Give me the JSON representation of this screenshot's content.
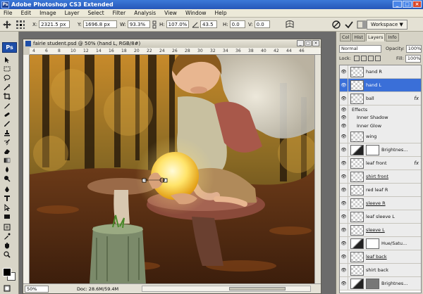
{
  "app": {
    "title": "Adobe Photoshop CS3 Extended",
    "badge": "Ps"
  },
  "menu": [
    "File",
    "Edit",
    "Image",
    "Layer",
    "Select",
    "Filter",
    "Analysis",
    "View",
    "Window",
    "Help"
  ],
  "options": {
    "x_label": "X:",
    "x_value": "2321.5 px",
    "y_label": "Y:",
    "y_value": "1696.8 px",
    "w_label": "W:",
    "w_value": "93.3%",
    "h_label": "H:",
    "h_value": "107.0%",
    "angle_value": "43.5",
    "hskew_label": "H:",
    "hskew_value": "0.0",
    "vskew_label": "V:",
    "vskew_value": "0.0",
    "workspace_label": "Workspace ▼"
  },
  "document": {
    "title": "fairie student.psd @ 50% (hand L, RGB/8#)",
    "zoom": "50%",
    "doc_info": "Doc: 28.6M/59.4M",
    "ruler_ticks": [
      "4",
      "6",
      "8",
      "10",
      "12",
      "14",
      "16",
      "18",
      "20",
      "22",
      "24",
      "26",
      "28",
      "30",
      "32",
      "34",
      "36",
      "38",
      "40",
      "42",
      "44",
      "46"
    ]
  },
  "panel": {
    "tabs": [
      "Col",
      "Hist",
      "Layers",
      "Info"
    ],
    "blend_mode": "Normal",
    "opacity_label": "Opacity:",
    "opacity_value": "100%",
    "lock_label": "Lock:",
    "fill_label": "Fill:",
    "fill_value": "100%",
    "layers": [
      {
        "name": "hand R",
        "type": "pixel"
      },
      {
        "name": "hand L",
        "type": "pixel",
        "active": true
      },
      {
        "name": "ball",
        "type": "pixel",
        "fx": true
      },
      {
        "name": "Effects",
        "type": "sub"
      },
      {
        "name": "Inner Shadow",
        "type": "sub"
      },
      {
        "name": "Inner Glow",
        "type": "sub"
      },
      {
        "name": "wing",
        "type": "pixel"
      },
      {
        "name": "Brightnes...",
        "type": "adjust"
      },
      {
        "name": "leaf front",
        "type": "pixel",
        "fx": true
      },
      {
        "name": "shirt front",
        "type": "pixel",
        "underline": true
      },
      {
        "name": "red leaf R",
        "type": "pixel"
      },
      {
        "name": "sleeve R",
        "type": "pixel",
        "underline": true
      },
      {
        "name": "leaf sleeve L",
        "type": "pixel"
      },
      {
        "name": "sleeve L",
        "type": "pixel",
        "underline": true
      },
      {
        "name": "Hue/Satu...",
        "type": "adjust"
      },
      {
        "name": "leaf back",
        "type": "pixel",
        "underline": true
      },
      {
        "name": "shirt back",
        "type": "pixel"
      },
      {
        "name": "Brightnes...",
        "type": "adjust"
      }
    ]
  },
  "colors": {
    "accent": "#3a6fd8",
    "titlebar": "#2557b8",
    "forest": "#4a3a1c"
  }
}
